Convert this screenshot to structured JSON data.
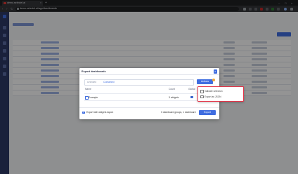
{
  "browser": {
    "tab_title": "demo.selectel.ai",
    "tab_close": "×",
    "new_tab": "+",
    "window_controls": [
      "–",
      "□",
      "×"
    ],
    "url": "demo.selectel.ai/app/dashboards"
  },
  "modal": {
    "title": "Export dashboards",
    "close_label": "×",
    "tabs": [
      "Unlinked",
      "Contained"
    ],
    "active_tab": "Contained",
    "actions_label": "Actions",
    "columns": [
      "Name",
      "Count",
      "Global"
    ],
    "rows": [
      {
        "name": "Example",
        "count": "3 widgets",
        "global": "✓"
      }
    ],
    "footer": {
      "checkbox_label": "Export with widgets layout",
      "checkbox_mark": "✓",
      "count_text": "0 dashboard groups, 1 dashboard",
      "export_label": "Export"
    }
  },
  "actions_menu": {
    "items": [
      "Validate selection",
      "Export as JSON"
    ]
  },
  "colors": {
    "accent": "#3f6de0",
    "sidebar": "#2d3a66",
    "highlight_border": "#e4364a"
  }
}
